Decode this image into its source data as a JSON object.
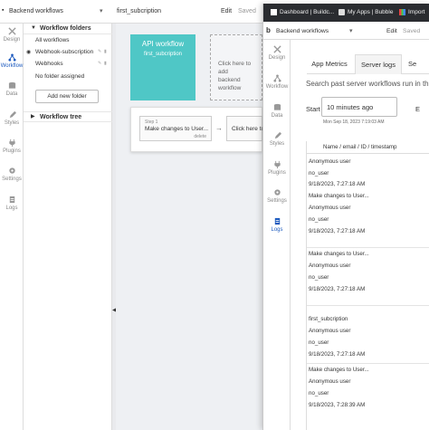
{
  "editor": {
    "title": "Backend workflows",
    "page_select": "first_subcription",
    "edit_label": "Edit",
    "saved_label": "Saved",
    "rail": [
      {
        "label": "Design",
        "icon": "design-icon"
      },
      {
        "label": "Workflow",
        "icon": "workflow-icon"
      },
      {
        "label": "Data",
        "icon": "data-icon"
      },
      {
        "label": "Styles",
        "icon": "styles-icon"
      },
      {
        "label": "Plugins",
        "icon": "plugins-icon"
      },
      {
        "label": "Settings",
        "icon": "settings-icon"
      },
      {
        "label": "Logs",
        "icon": "logs-icon"
      }
    ],
    "folders_header": "Workflow folders",
    "folders": [
      "All workflows",
      "Webhook-subscription",
      "Webhooks",
      "No folder assigned"
    ],
    "add_folder_label": "Add new folder",
    "tree_header": "Workflow tree",
    "api_card_title": "API workflow",
    "api_card_name": "first_subcription",
    "add_action_text_1": "Click here to add",
    "add_action_text_2": "backend workflow",
    "step_label": "Step 1",
    "step_name": "Make changes to User...",
    "step_delete": "delete",
    "step_next": "Click here to add"
  },
  "browser": {
    "tabs": [
      {
        "label": "Dashboard | Buildc..."
      },
      {
        "label": "My Apps | Bubble"
      },
      {
        "label": "Import"
      }
    ]
  },
  "popup": {
    "title": "Backend workflows",
    "edit_label": "Edit",
    "saved_label": "Saved",
    "rail": [
      {
        "label": "Design",
        "icon": "design-icon"
      },
      {
        "label": "Workflow",
        "icon": "workflow-icon"
      },
      {
        "label": "Data",
        "icon": "data-icon"
      },
      {
        "label": "Styles",
        "icon": "styles-icon"
      },
      {
        "label": "Plugins",
        "icon": "plugins-icon"
      },
      {
        "label": "Settings",
        "icon": "settings-icon"
      },
      {
        "label": "Logs",
        "icon": "logs-icon"
      }
    ],
    "tabs": [
      "App Metrics",
      "Server logs",
      "Se"
    ],
    "search_text": "Search past server workflows run in th",
    "start_label": "Start",
    "start_value": "10 minutes ago",
    "start_sub": "Mon Sep 18, 2023 7:19:03 AM",
    "end_label": "E",
    "column_header": "Name / email / ID / timestamp",
    "rows": [
      [
        "Anonymous user",
        "no_user",
        "9/18/2023, 7:27:18 AM"
      ],
      [
        "Make changes to User...",
        "Anonymous user",
        "no_user",
        "9/18/2023, 7:27:18 AM"
      ],
      [
        "Make changes to User...",
        "Anonymous user",
        "no_user",
        "9/18/2023, 7:27:18 AM"
      ],
      [
        "first_subcription",
        "Anonymous user",
        "no_user",
        "9/18/2023, 7:27:18 AM"
      ],
      [
        "Make changes to User...",
        "Anonymous user",
        "no_user",
        "9/18/2023, 7:28:39 AM"
      ]
    ]
  },
  "colors": {
    "accent": "#1d5bbf",
    "api_card": "#4fc7c6",
    "tab_bar": "#2a2c30"
  }
}
